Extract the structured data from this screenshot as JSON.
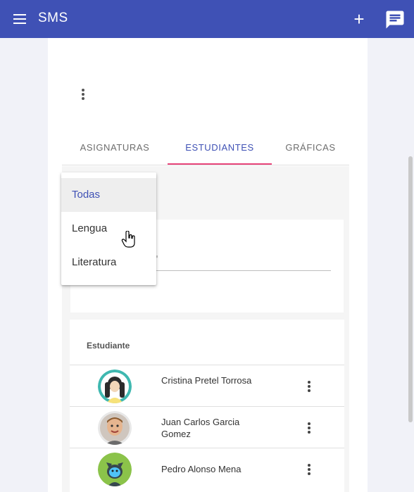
{
  "app": {
    "title": "SMS",
    "colors": {
      "primary": "#3f51b5",
      "tab_indicator": "#e8457a"
    },
    "icons": [
      "menu-icon",
      "add-icon",
      "message-icon",
      "more-vert-icon",
      "hand-cursor-icon"
    ]
  },
  "toolbar": {
    "add_label": "+"
  },
  "tabs": [
    {
      "label": "ASIGNATURAS",
      "active": false
    },
    {
      "label": "ESTUDIANTES",
      "active": true
    },
    {
      "label": "GRÁFICAS",
      "active": false
    }
  ],
  "search": {
    "placeholder_fragment": "r\""
  },
  "table": {
    "header": "Estudiante",
    "rows": [
      {
        "name": "Cristina Pretel Torrosa"
      },
      {
        "name": "Juan Carlos Garcia Gomez"
      },
      {
        "name": "Pedro Alonso Mena"
      }
    ]
  },
  "dropdown": {
    "items": [
      {
        "label": "Todas",
        "selected": true
      },
      {
        "label": "Lengua",
        "selected": false
      },
      {
        "label": "Literatura",
        "selected": false
      }
    ]
  }
}
